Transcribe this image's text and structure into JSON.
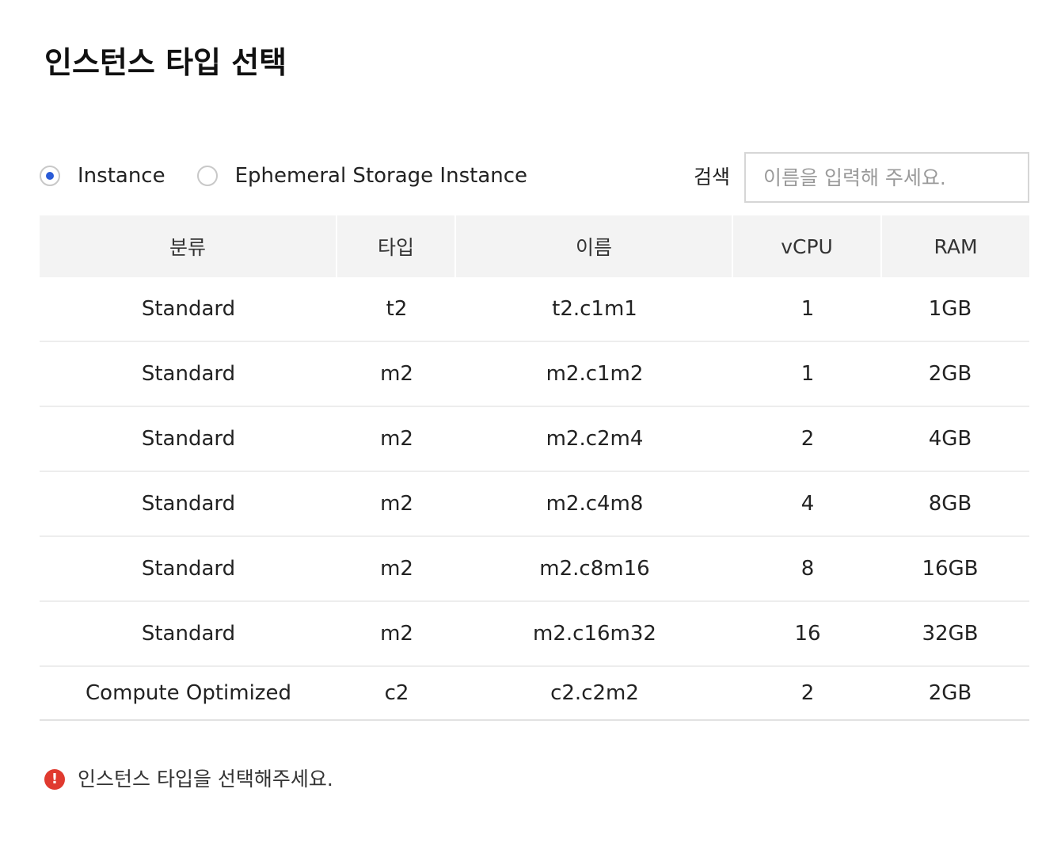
{
  "page": {
    "title": "인스턴스 타입 선택"
  },
  "filter": {
    "options": [
      {
        "label": "Instance",
        "checked": true
      },
      {
        "label": "Ephemeral Storage Instance",
        "checked": false
      }
    ],
    "search_label": "검색",
    "search_placeholder": "이름을 입력해 주세요.",
    "search_value": ""
  },
  "table": {
    "columns": [
      "분류",
      "타입",
      "이름",
      "vCPU",
      "RAM"
    ],
    "rows": [
      [
        "Standard",
        "t2",
        "t2.c1m1",
        "1",
        "1GB"
      ],
      [
        "Standard",
        "m2",
        "m2.c1m2",
        "1",
        "2GB"
      ],
      [
        "Standard",
        "m2",
        "m2.c2m4",
        "2",
        "4GB"
      ],
      [
        "Standard",
        "m2",
        "m2.c4m8",
        "4",
        "8GB"
      ],
      [
        "Standard",
        "m2",
        "m2.c8m16",
        "8",
        "16GB"
      ],
      [
        "Standard",
        "m2",
        "m2.c16m32",
        "16",
        "32GB"
      ],
      [
        "Compute Optimized",
        "c2",
        "c2.c2m2",
        "2",
        "2GB"
      ]
    ]
  },
  "validation": {
    "icon": "exclamation-icon",
    "icon_glyph": "!",
    "message": "인스턴스 타입을 선택해주세요.",
    "color": "#e03a2f"
  },
  "colors": {
    "accent": "#2a5bd7",
    "header_bg": "#f3f3f3"
  }
}
